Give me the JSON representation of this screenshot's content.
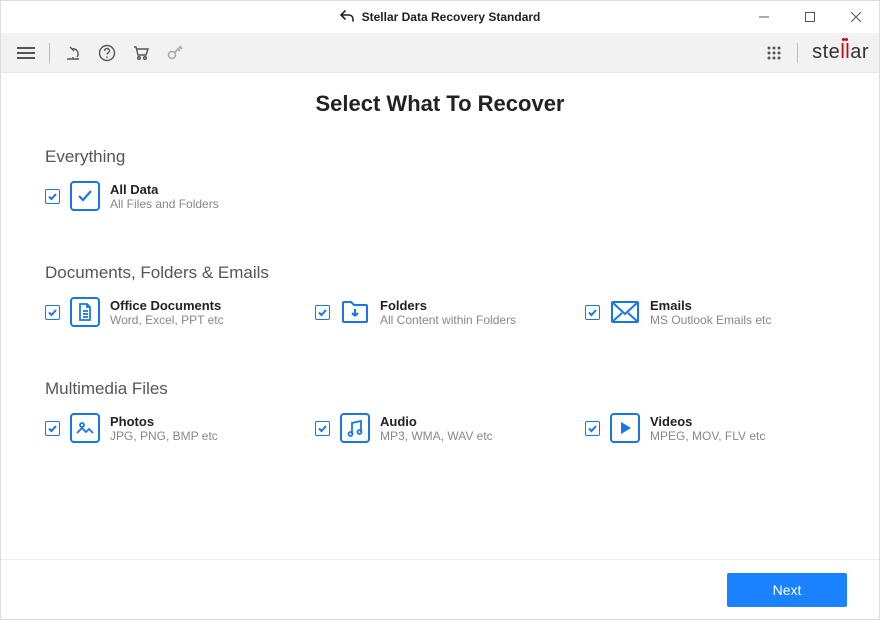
{
  "window": {
    "title": "Stellar Data Recovery Standard"
  },
  "brand": "stellar",
  "page": {
    "title": "Select What To Recover"
  },
  "sections": {
    "everything": {
      "title": "Everything",
      "items": {
        "all_data": {
          "title": "All Data",
          "desc": "All Files and Folders",
          "checked": true
        }
      }
    },
    "documents": {
      "title": "Documents, Folders & Emails",
      "items": {
        "office": {
          "title": "Office Documents",
          "desc": "Word, Excel, PPT etc",
          "checked": true
        },
        "folders": {
          "title": "Folders",
          "desc": "All Content within Folders",
          "checked": true
        },
        "emails": {
          "title": "Emails",
          "desc": "MS Outlook Emails etc",
          "checked": true
        }
      }
    },
    "multimedia": {
      "title": "Multimedia Files",
      "items": {
        "photos": {
          "title": "Photos",
          "desc": "JPG, PNG, BMP etc",
          "checked": true
        },
        "audio": {
          "title": "Audio",
          "desc": "MP3, WMA, WAV etc",
          "checked": true
        },
        "videos": {
          "title": "Videos",
          "desc": "MPEG, MOV, FLV etc",
          "checked": true
        }
      }
    }
  },
  "footer": {
    "next": "Next"
  }
}
